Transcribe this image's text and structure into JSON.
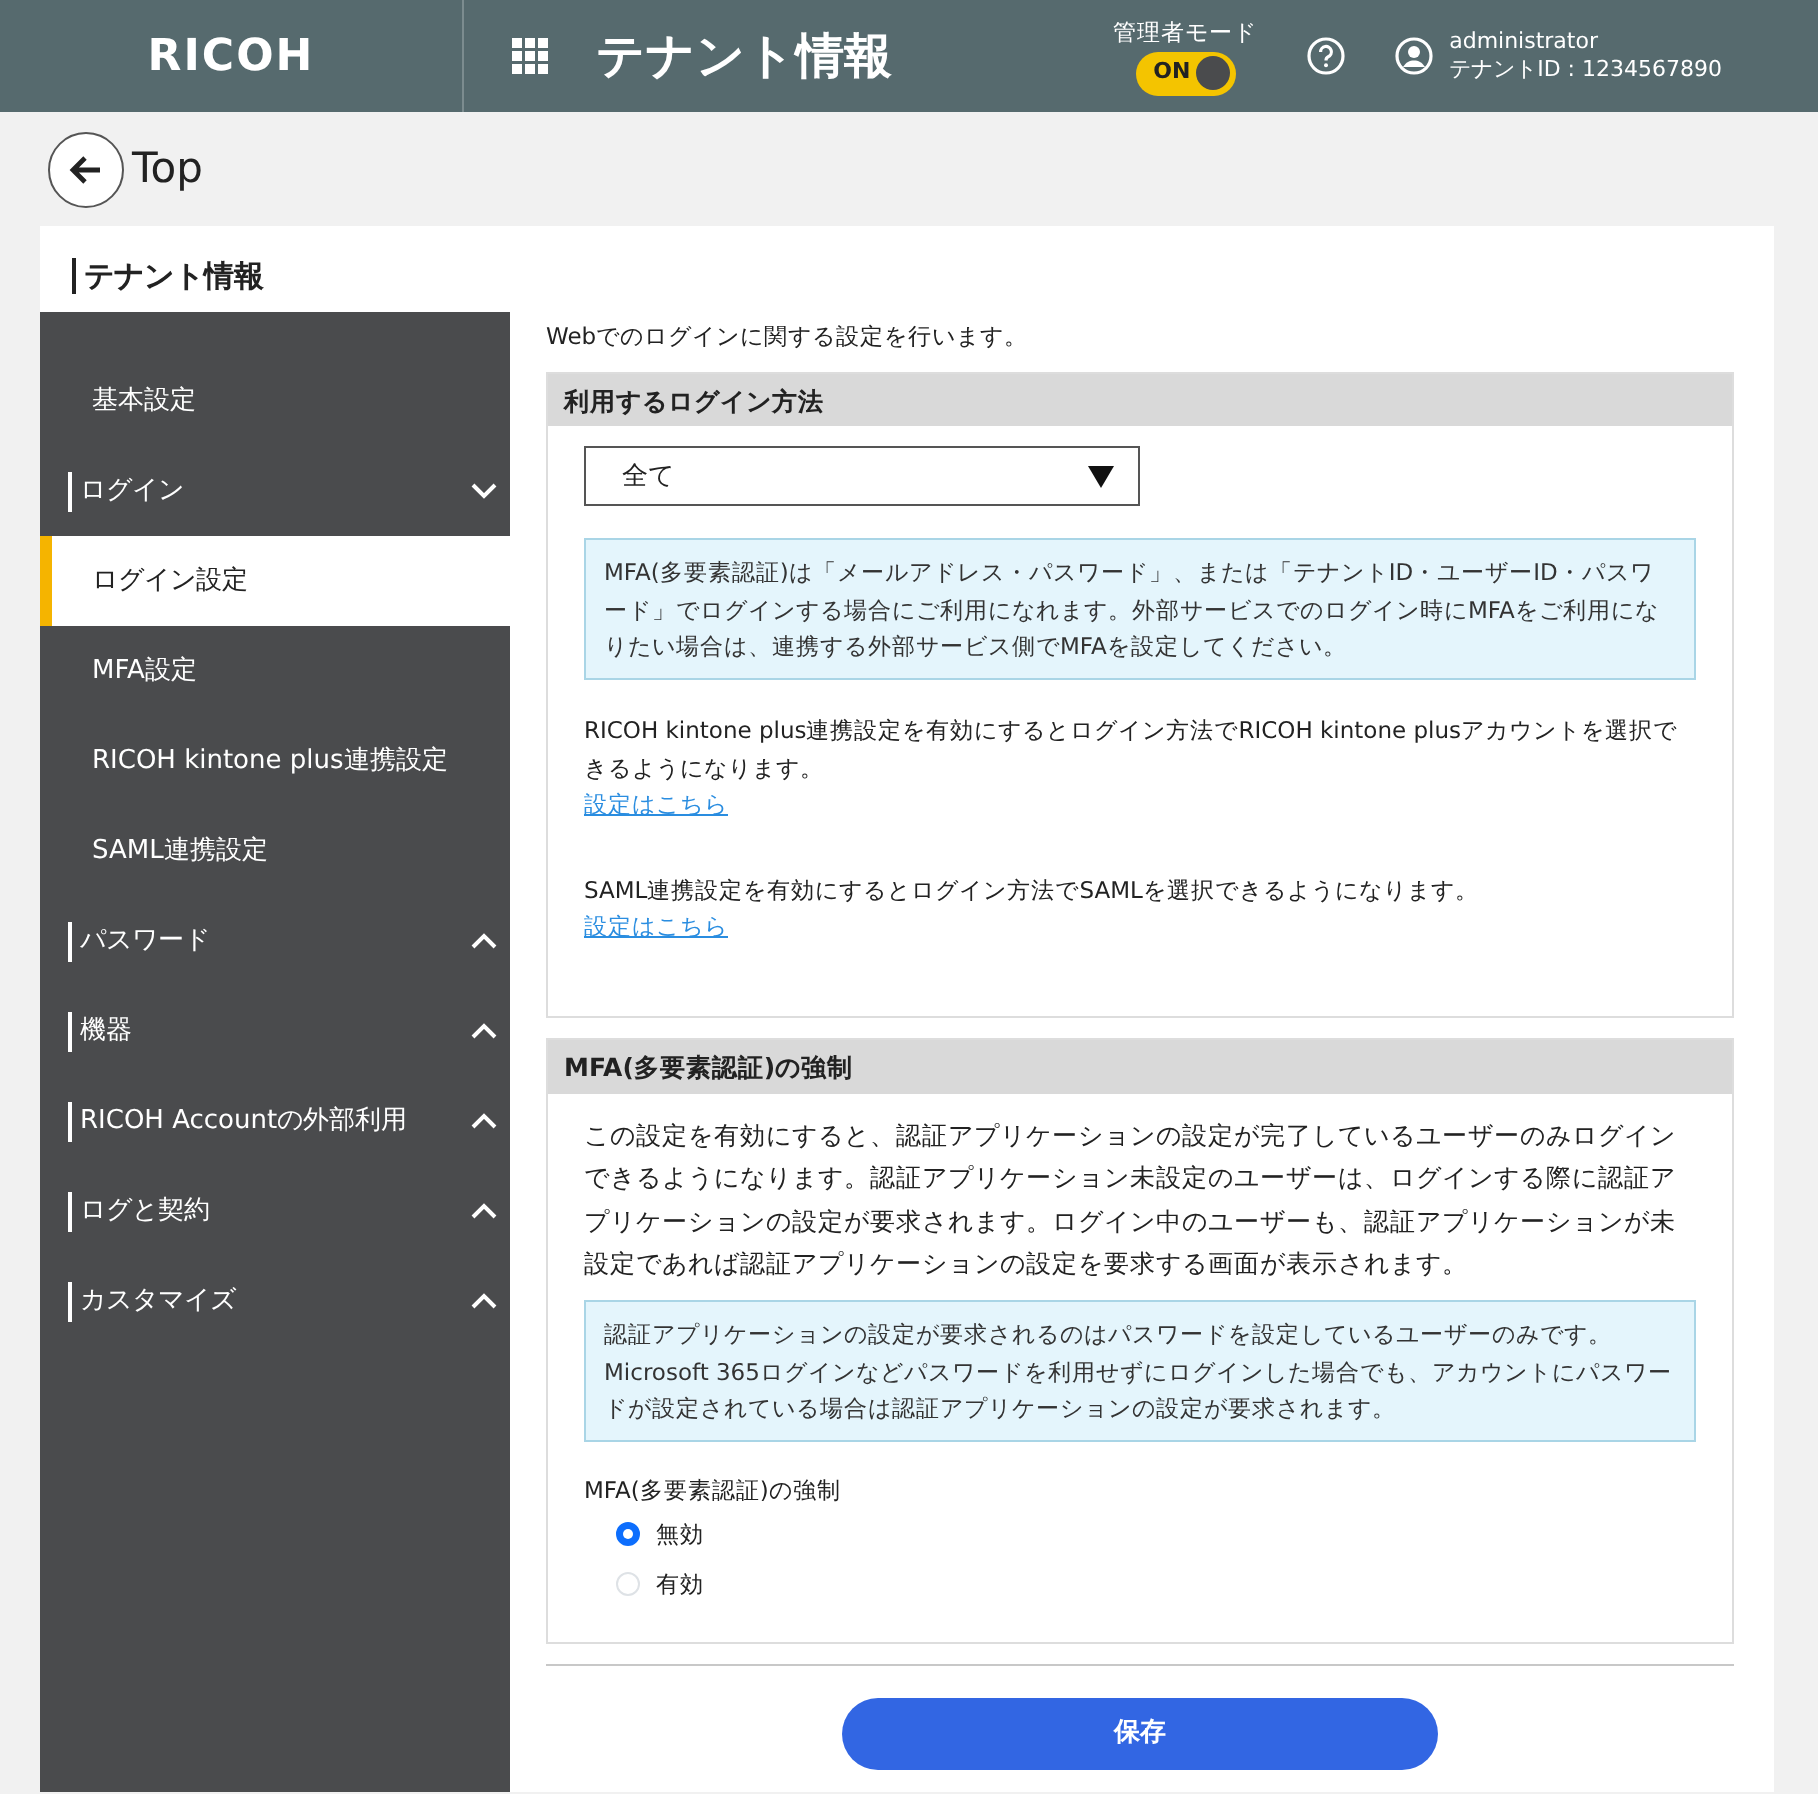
{
  "header": {
    "logo": "RICOH",
    "title": "テナント情報",
    "admin_mode": {
      "label": "管理者モード",
      "toggle_text": "ON",
      "on": true
    },
    "user": {
      "name": "administrator",
      "tenant": "テナントID : 1234567890"
    }
  },
  "back": {
    "label": "Top"
  },
  "panel_title": "テナント情報",
  "sidebar": {
    "items": [
      {
        "kind": "link",
        "label": "基本設定",
        "selected": false
      },
      {
        "kind": "group",
        "label": "ログイン",
        "expanded": true,
        "children": [
          {
            "label": "ログイン設定",
            "selected": true
          },
          {
            "label": "MFA設定",
            "selected": false
          },
          {
            "label": "RICOH kintone plus連携設定",
            "selected": false
          },
          {
            "label": "SAML連携設定",
            "selected": false
          }
        ]
      },
      {
        "kind": "group",
        "label": "パスワード",
        "expanded": false
      },
      {
        "kind": "group",
        "label": "機器",
        "expanded": false
      },
      {
        "kind": "group",
        "label": "RICOH Accountの外部利用",
        "expanded": false
      },
      {
        "kind": "group",
        "label": "ログと契約",
        "expanded": false
      },
      {
        "kind": "group",
        "label": "カスタマイズ",
        "expanded": false
      }
    ]
  },
  "intro": "Webでのログインに関する設定を行います。",
  "sections": [
    {
      "title": "利用するログイン方法",
      "blocks": [
        {
          "kind": "select",
          "value": "全て"
        },
        {
          "kind": "info",
          "text": "MFA(多要素認証)は「メールアドレス・パスワード」、または「テナントID・ユーザーID・パスワード」でログインする場合にご利用になれます。外部サービスでのログイン時にMFAをご利用になりたい場合は、連携する外部サービス側でMFAを設定してください。"
        },
        {
          "kind": "text_link",
          "text": "RICOH kintone plus連携設定を有効にするとログイン方法でRICOH kintone plusアカウントを選択できるようになります。",
          "link": "設定はこちら"
        },
        {
          "kind": "text_link",
          "text": "SAML連携設定を有効にするとログイン方法でSAMLを選択できるようになります。",
          "link": "設定はこちら"
        }
      ]
    },
    {
      "title": "MFA(多要素認証)の強制",
      "blocks": [
        {
          "kind": "text",
          "text": "この設定を有効にすると、認証アプリケーションの設定が完了しているユーザーのみログインできるようになります。認証アプリケーション未設定のユーザーは、ログインする際に認証アプリケーションの設定が要求されます。ログイン中のユーザーも、認証アプリケーションが未設定であれば認証アプリケーションの設定を要求する画面が表示されます。"
        },
        {
          "kind": "info",
          "text": "認証アプリケーションの設定が要求されるのはパスワードを設定しているユーザーのみです。Microsoft 365ログインなどパスワードを利用せずにログインした場合でも、アカウントにパスワードが設定されている場合は認証アプリケーションの設定が要求されます。"
        },
        {
          "kind": "radio",
          "label": "MFA(多要素認証)の強制",
          "options": [
            {
              "label": "無効",
              "selected": true
            },
            {
              "label": "有効",
              "selected": false
            }
          ]
        }
      ]
    }
  ],
  "save_button": "保存"
}
